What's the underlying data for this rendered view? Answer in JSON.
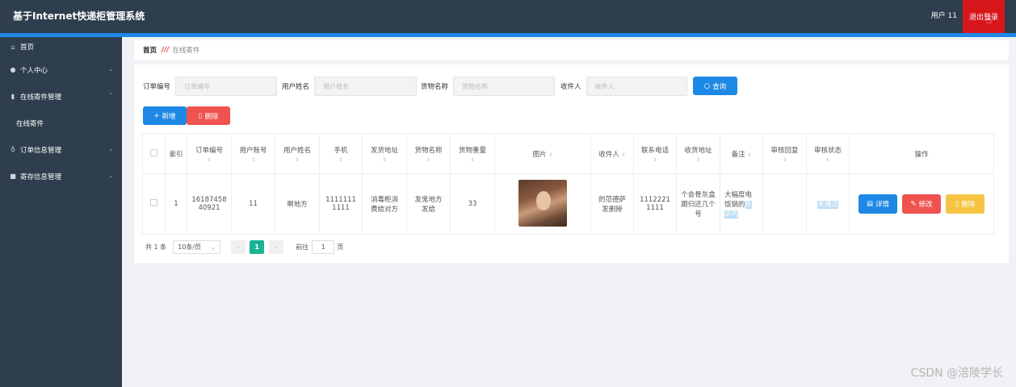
{
  "header": {
    "title": "基于Internet快递柜管理系统",
    "user": "用户 11",
    "logout": "退出登录"
  },
  "sidebar": {
    "items": [
      {
        "label": "首页",
        "icon": "home-icon"
      },
      {
        "label": "个人中心",
        "icon": "user-icon"
      },
      {
        "label": "在线寄件管理",
        "icon": "bar-chart-icon"
      },
      {
        "label": "在线寄件",
        "icon": ""
      },
      {
        "label": "订单信息管理",
        "icon": "microphone-icon"
      },
      {
        "label": "寄存信息管理",
        "icon": "box-icon"
      }
    ]
  },
  "breadcrumb": {
    "home": "首页",
    "current": "在线寄件"
  },
  "filters": [
    {
      "label": "订单编号",
      "placeholder": "订单编号"
    },
    {
      "label": "用户姓名",
      "placeholder": "用户姓名"
    },
    {
      "label": "货物名称",
      "placeholder": "货物名称"
    },
    {
      "label": "收件人",
      "placeholder": "收件人"
    }
  ],
  "actions": {
    "search": "查询",
    "add": "新增",
    "delete": "删除"
  },
  "table": {
    "columns": [
      "索引",
      "订单编号",
      "用户账号",
      "用户姓名",
      "手机",
      "发货地址",
      "货物名称",
      "货物重量",
      "图片",
      "收件人",
      "联系电话",
      "收货地址",
      "备注",
      "审核回复",
      "审核状态",
      "操作"
    ],
    "row": {
      "index": "1",
      "order_no": "1618745840921",
      "account": "11",
      "name": "啊地方",
      "phone": "11111111111",
      "ship_addr": "消毒柜消费给对方",
      "goods": "发鬼地方发给",
      "weight": "33",
      "receiver": "的范德萨发删掉",
      "contact": "11122211111",
      "recv_addr": "个会骨灰盒跟归还几个号",
      "remark_plain": "大幅度电饭锅的",
      "remark_hl": "告诉内",
      "review_reply": "",
      "review_status": "未通过",
      "op_detail": "详情",
      "op_edit": "修改",
      "op_delete": "删除"
    }
  },
  "pagination": {
    "total": "共 1 条",
    "page_size": "10条/页",
    "current": "1",
    "goto_label": "前往",
    "goto_value": "1",
    "page_unit": "页"
  },
  "watermark": "CSDN @涪陵学长"
}
